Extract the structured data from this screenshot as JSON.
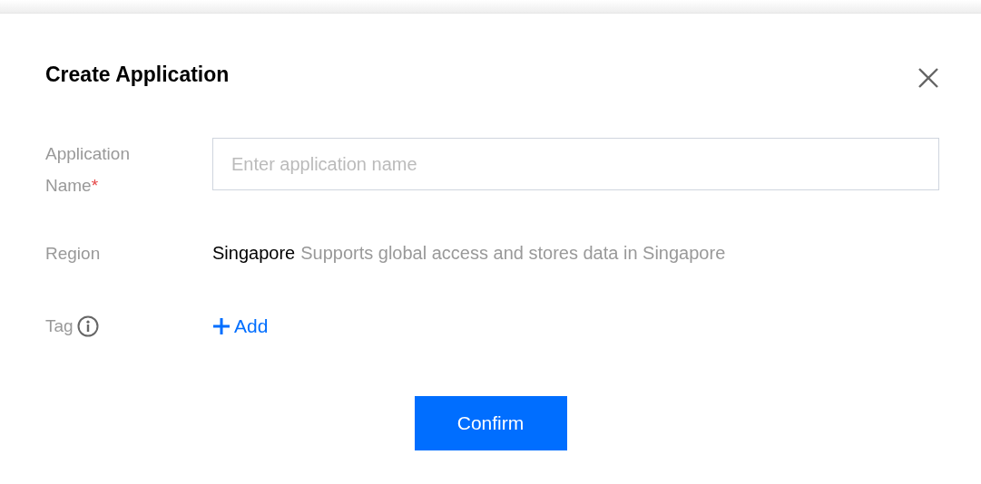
{
  "dialog": {
    "title": "Create Application",
    "closable": true
  },
  "fields": [
    {
      "kind": "input",
      "label": "Application Name",
      "required_mark": "*",
      "placeholder": "Enter application name"
    },
    {
      "kind": "text",
      "label": "Region",
      "value": "Singapore",
      "description": "Supports global access and stores data in Singapore"
    },
    {
      "kind": "tag",
      "label": "Tag",
      "info": true,
      "action": "Add"
    }
  ],
  "buttons": [
    {
      "label": "Confirm",
      "kind": "primary"
    }
  ]
}
